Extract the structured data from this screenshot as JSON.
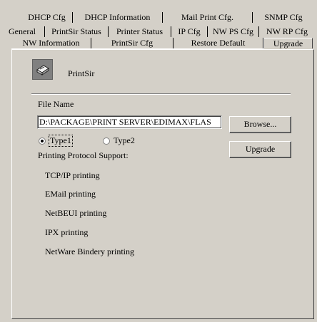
{
  "tabs": {
    "row1": [
      "DHCP Cfg",
      "DHCP Information",
      "Mail Print Cfg.",
      "SNMP Cfg"
    ],
    "row2": [
      "General",
      "PrintSir Status",
      "Printer Status",
      "IP Cfg",
      "NW PS Cfg",
      "NW RP Cfg"
    ],
    "row3": [
      "NW Information",
      "PrintSir Cfg",
      "Restore Default",
      "Upgrade"
    ],
    "active": "Upgrade"
  },
  "device": {
    "name": "PrintSir",
    "icon": "printer-icon"
  },
  "upgrade": {
    "file_name_label": "File Name",
    "file_path": "D:\\PACKAGE\\PRINT SERVER\\EDIMAX\\FLAS",
    "browse_label": "Browse...",
    "upgrade_label": "Upgrade",
    "type1_label": "Type1",
    "type2_label": "Type2",
    "selected_type": "Type1"
  },
  "protocols": {
    "heading": "Printing Protocol Support:",
    "items": [
      "TCP/IP printing",
      "EMail printing",
      "NetBEUI printing",
      "IPX printing",
      "NetWare Bindery printing"
    ]
  }
}
